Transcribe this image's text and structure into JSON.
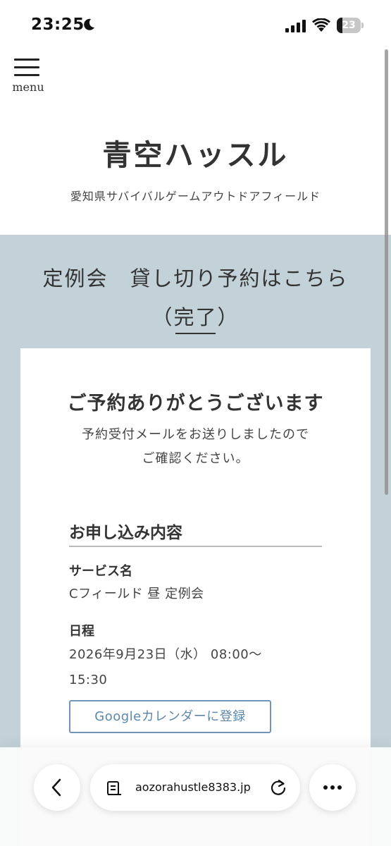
{
  "status_bar": {
    "time": "23:25",
    "battery": "23"
  },
  "header": {
    "menu_label": "menu",
    "title": "青空ハッスル",
    "subtitle": "愛知県サバイバルゲームアウトドアフィールド"
  },
  "section": {
    "title_line1": "定例会　貸し切り予約はこちら",
    "title_line2": "（完了）"
  },
  "confirmation": {
    "thanks": "ご予約ありがとうございます",
    "message_line1": "予約受付メールをお送りしましたので",
    "message_line2": "ご確認ください。"
  },
  "details": {
    "heading": "お申し込み内容",
    "service_label": "サービス名",
    "service_value": "Cフィールド 昼 定例会",
    "schedule_label": "日程",
    "schedule_line1": "2026年9月23日（水） 08:00〜",
    "schedule_line2": "15:30",
    "calendar_button": "Googleカレンダーに登録"
  },
  "browser": {
    "url": "aozorahustle8383.jp"
  },
  "colors": {
    "section_bg": "#c3d2d9",
    "button_border": "#6f96b8"
  },
  "icons": [
    "moon-icon",
    "signal-icon",
    "wifi-icon",
    "battery-icon",
    "hamburger-icon",
    "back-icon",
    "page-icon",
    "reload-icon",
    "more-icon"
  ]
}
